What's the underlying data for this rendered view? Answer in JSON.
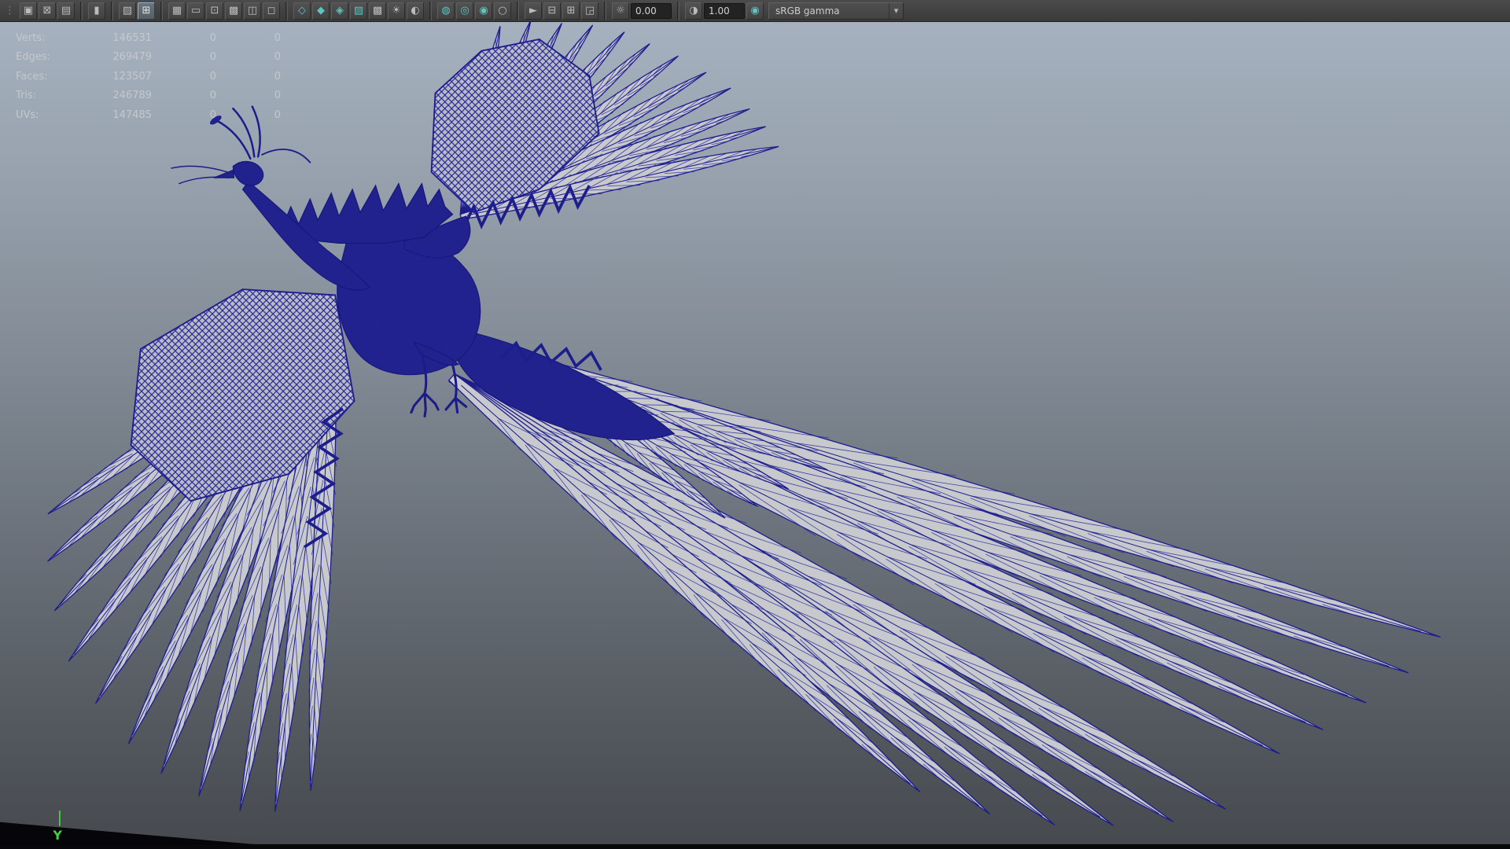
{
  "colors": {
    "accent_teal": "#5ec4c0",
    "wireframe_navy": "#1c1c8c",
    "hud_text": "#c4c8cc"
  },
  "toolbar": {
    "grip_glyph": "⋮",
    "groups": [
      {
        "items": [
          {
            "name": "select-camera-icon",
            "glyph": "▣"
          },
          {
            "name": "lock-camera-icon",
            "glyph": "⊠"
          },
          {
            "name": "camera-attributes-icon",
            "glyph": "▤"
          }
        ]
      },
      {
        "items": [
          {
            "name": "bookmark-icon",
            "glyph": "▮"
          }
        ]
      },
      {
        "items": [
          {
            "name": "image-plane-icon",
            "glyph": "▧"
          },
          {
            "name": "two-d-pan-zoom-icon",
            "glyph": "⊞",
            "active": true
          }
        ]
      },
      {
        "items": [
          {
            "name": "grid-icon",
            "glyph": "▦"
          },
          {
            "name": "film-gate-icon",
            "glyph": "▭"
          },
          {
            "name": "resolution-gate-icon",
            "glyph": "⊡"
          },
          {
            "name": "gate-mask-icon",
            "glyph": "▩"
          },
          {
            "name": "safe-action-icon",
            "glyph": "◫"
          },
          {
            "name": "safe-title-icon",
            "glyph": "◻"
          }
        ]
      },
      {
        "items": [
          {
            "name": "wireframe-icon",
            "glyph": "◇",
            "tint": true
          },
          {
            "name": "smooth-shade-icon",
            "glyph": "◆",
            "tint": true
          },
          {
            "name": "wireframe-on-shaded-icon",
            "glyph": "◈",
            "tint": true
          },
          {
            "name": "textured-icon",
            "glyph": "▨",
            "tint": true
          },
          {
            "name": "use-default-material-icon",
            "glyph": "▩"
          },
          {
            "name": "lighting-icon",
            "glyph": "☀"
          },
          {
            "name": "shadows-icon",
            "glyph": "◐"
          }
        ]
      },
      {
        "items": [
          {
            "name": "occlusion-icon",
            "glyph": "◍",
            "tint": true
          },
          {
            "name": "motion-blur-icon",
            "glyph": "◎",
            "tint": true
          },
          {
            "name": "multisample-icon",
            "glyph": "◉",
            "tint": true
          },
          {
            "name": "depth-peeling-icon",
            "glyph": "○"
          }
        ]
      },
      {
        "items": [
          {
            "name": "isolate-select-icon",
            "glyph": "►"
          },
          {
            "name": "subtract-view-icon",
            "glyph": "⊟"
          },
          {
            "name": "add-view-icon",
            "glyph": "⊞"
          },
          {
            "name": "snapshot-icon",
            "glyph": "◲"
          }
        ]
      }
    ],
    "exposure": {
      "icon_glyph": "☼",
      "value": "0.00"
    },
    "gamma": {
      "icon_glyph": "◑",
      "value": "1.00"
    },
    "color_management": {
      "icon_glyph": "◉"
    },
    "colorspace": {
      "value": "sRGB gamma",
      "arrow_glyph": "▾"
    }
  },
  "hud": {
    "rows": [
      {
        "label": "Verts:",
        "value": "146531",
        "c2": "0",
        "c3": "0"
      },
      {
        "label": "Edges:",
        "value": "269479",
        "c2": "0",
        "c3": "0"
      },
      {
        "label": "Faces:",
        "value": "123507",
        "c2": "0",
        "c3": "0"
      },
      {
        "label": "Tris:",
        "value": "246789",
        "c2": "0",
        "c3": "0"
      },
      {
        "label": "UVs:",
        "value": "147485",
        "c2": "0",
        "c3": "0"
      }
    ]
  },
  "viewport": {
    "axis_label": "Y"
  }
}
